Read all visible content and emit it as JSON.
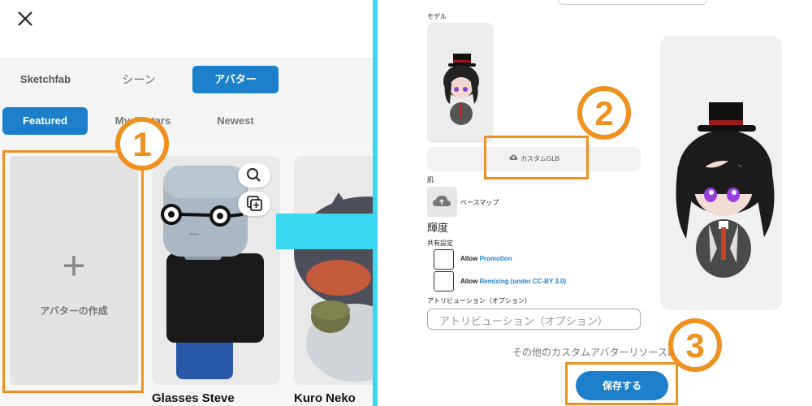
{
  "left": {
    "close_label": "×",
    "tabs": [
      {
        "label": "Sketchfab"
      },
      {
        "label": "シーン"
      },
      {
        "label": "アバター"
      }
    ],
    "filters": [
      {
        "label": "Featured"
      },
      {
        "label": "My Avatars"
      },
      {
        "label": "Newest"
      }
    ],
    "create_card": {
      "plus": "+",
      "label": "アバターの作成"
    },
    "avatars": [
      {
        "name": "Glasses Steve"
      },
      {
        "name": "Kuro Neko"
      }
    ],
    "icons": [
      "search-icon",
      "add-to-library-icon"
    ]
  },
  "right": {
    "model_label": "モデル",
    "custom_glb": "カスタムGLB",
    "skin_label": "肌",
    "basemap_label": "ベースマップ",
    "brightness_label": "輝度",
    "share_settings_label": "共有設定",
    "allow_label": "Allow",
    "promotion": {
      "label": "Promotion"
    },
    "remixing": {
      "label": "Remixing (under CC-BY 3.0)"
    },
    "attribution_label": "アトリビューション（オプション）",
    "attribution_placeholder": "アトリビューション（オプション）",
    "resources_text": "その他のカスタムアバターリソースはこちら",
    "save_label": "保存する"
  },
  "steps": [
    "1",
    "2",
    "3"
  ],
  "colors": {
    "accent_blue": "#1c7fcb",
    "highlight_orange": "#f0901e",
    "divider_cyan": "#3ad8f0"
  }
}
